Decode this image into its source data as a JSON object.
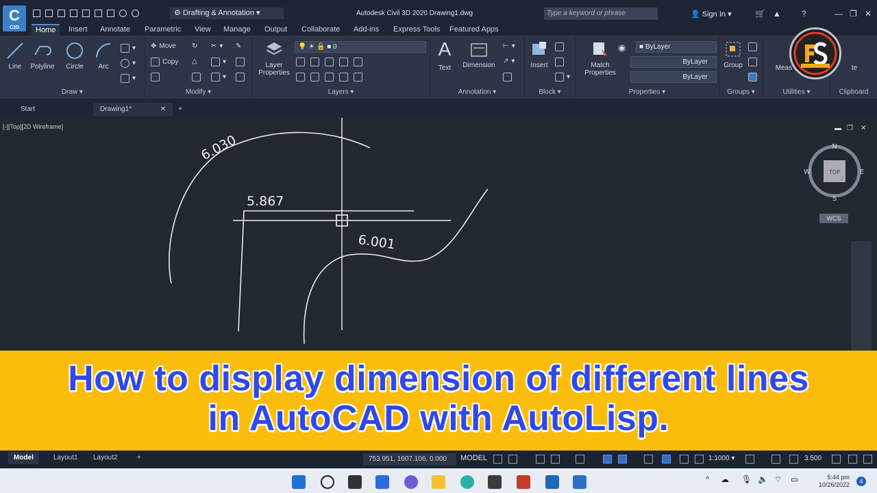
{
  "app": {
    "logo_text": "C",
    "logo_sub": "C3D",
    "workspace": "Drafting & Annotation",
    "title": "Autodesk Civil 3D 2020   Drawing1.dwg",
    "search_placeholder": "Type a keyword or phrase",
    "sign_in": "Sign In"
  },
  "ribbon_tabs": [
    "Home",
    "Insert",
    "Annotate",
    "Parametric",
    "View",
    "Manage",
    "Output",
    "Collaborate",
    "Add-ins",
    "Express Tools",
    "Featured Apps"
  ],
  "ribbon": {
    "draw": {
      "title": "Draw",
      "line": "Line",
      "polyline": "Polyline",
      "circle": "Circle",
      "arc": "Arc"
    },
    "modify": {
      "title": "Modify",
      "move": "Move",
      "copy": "Copy"
    },
    "layers": {
      "title": "Layers",
      "layer_properties_1": "Layer",
      "layer_properties_2": "Properties",
      "current_layer": "0"
    },
    "annotation": {
      "title": "Annotation",
      "text": "Text",
      "dimension": "Dimension"
    },
    "block": {
      "title": "Block",
      "insert": "Insert"
    },
    "properties": {
      "title": "Properties",
      "match_1": "Match",
      "match_2": "Properties",
      "color": "ByLayer",
      "linetype": "ByLayer",
      "lineweight": "ByLayer"
    },
    "groups": {
      "title": "Groups",
      "group": "Group"
    },
    "utilities": {
      "title": "Utilities",
      "measure": "Meas"
    },
    "clipboard": {
      "title": "Clipboard",
      "paste_partial": "te"
    }
  },
  "doc_tabs": {
    "start": "Start",
    "drawing": "Drawing1*"
  },
  "viewport": {
    "label": "[-][Top][2D Wireframe]",
    "compass": {
      "n": "N",
      "s": "S",
      "e": "E",
      "w": "W",
      "top": "TOP"
    },
    "wcs": "WCS"
  },
  "dimensions": {
    "arc": "6.030",
    "line": "5.867",
    "spline": "6.001"
  },
  "banner": {
    "line1": "How to display dimension of different lines",
    "line2": "in AutoCAD with AutoLisp."
  },
  "statusbar": {
    "layouts": [
      "Model",
      "Layout1",
      "Layout2"
    ],
    "coordinates": "753.951, 1607.106, 0.000",
    "space": "MODEL",
    "scale": "1:1000",
    "annotation_value": "3.500"
  },
  "taskbar": {
    "time": "5:44 pm",
    "date": "10/26/2022",
    "notifications": "4"
  },
  "colors": {
    "banner_bg": "#fbbd0c",
    "banner_text": "#2f48e6",
    "canvas_bg": "#212830"
  }
}
